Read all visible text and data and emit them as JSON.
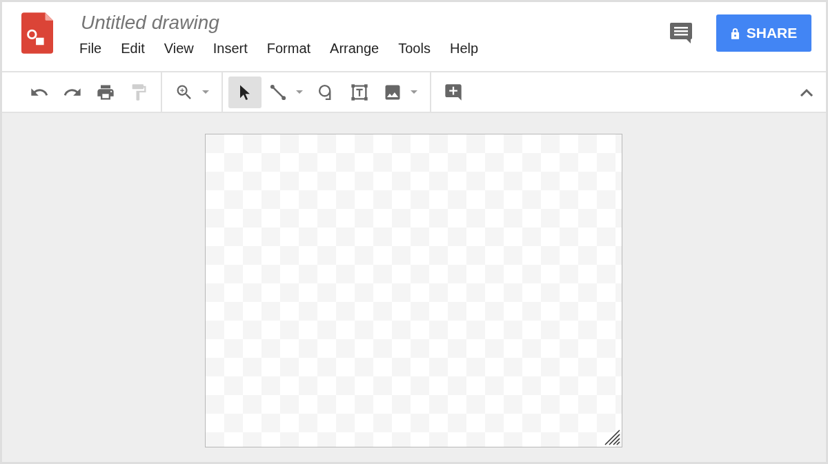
{
  "document": {
    "title": "Untitled drawing"
  },
  "menu": [
    "File",
    "Edit",
    "View",
    "Insert",
    "Format",
    "Arrange",
    "Tools",
    "Help"
  ],
  "share_button": {
    "label": "SHARE"
  },
  "toolbar": {
    "groups": [
      {
        "tools": [
          {
            "kind": "undo",
            "selected": false,
            "disabled": false,
            "dropdown": false
          },
          {
            "kind": "redo",
            "selected": false,
            "disabled": false,
            "dropdown": false
          },
          {
            "kind": "print",
            "selected": false,
            "disabled": false,
            "dropdown": false
          },
          {
            "kind": "paint",
            "selected": false,
            "disabled": true,
            "dropdown": false
          }
        ]
      },
      {
        "tools": [
          {
            "kind": "zoom",
            "selected": false,
            "disabled": false,
            "dropdown": true
          }
        ]
      },
      {
        "tools": [
          {
            "kind": "select",
            "selected": true,
            "disabled": false,
            "dropdown": false
          },
          {
            "kind": "line",
            "selected": false,
            "disabled": false,
            "dropdown": true
          },
          {
            "kind": "shape",
            "selected": false,
            "disabled": false,
            "dropdown": false
          },
          {
            "kind": "textbox",
            "selected": false,
            "disabled": false,
            "dropdown": false
          },
          {
            "kind": "image",
            "selected": false,
            "disabled": false,
            "dropdown": true
          }
        ]
      },
      {
        "tools": [
          {
            "kind": "comment",
            "selected": false,
            "disabled": false,
            "dropdown": false
          }
        ]
      }
    ]
  }
}
